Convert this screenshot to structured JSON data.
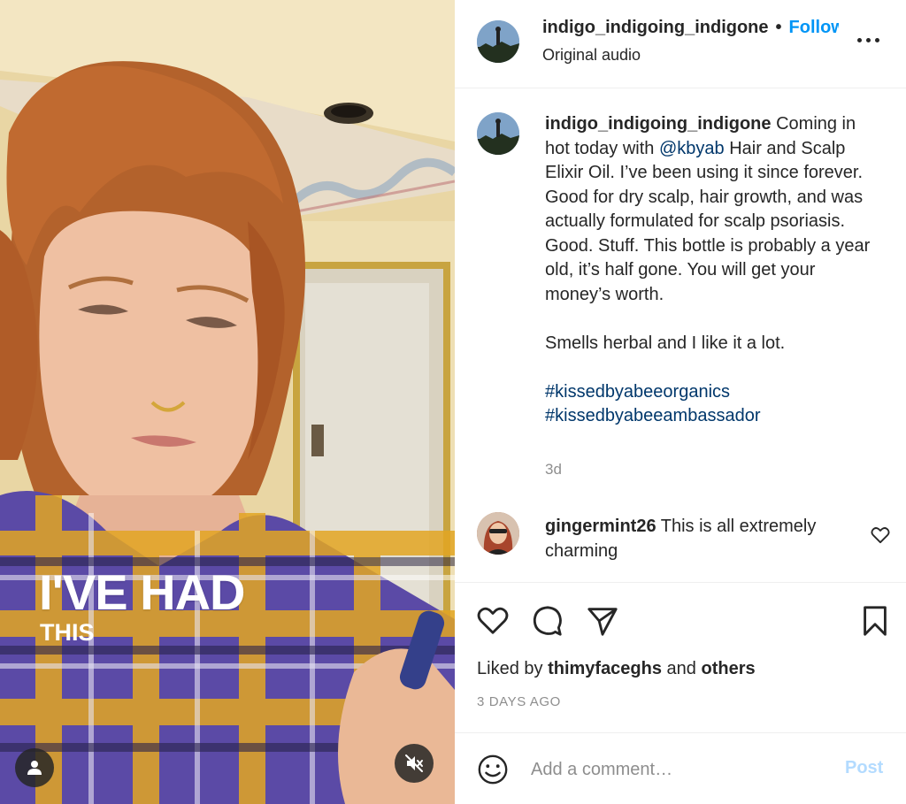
{
  "media": {
    "caption_big": "I'VE HAD",
    "caption_small": "THIS",
    "user_button_icon": "user-icon",
    "mute_button_icon": "speaker-muted-icon"
  },
  "header": {
    "username": "indigo_indigoing_indigone",
    "separator": "•",
    "follow_label": "Follow",
    "audio": "Original audio"
  },
  "caption": {
    "username": "indigo_indigoing_indigone",
    "text_part1": " Coming in hot today with ",
    "mention": "@kbyab",
    "text_part2": " Hair and Scalp Elixir Oil. I’ve been using it since forever. Good for dry scalp, hair growth, and was actually formulated for scalp psoriasis. Good. Stuff. This bottle is probably a year old, it’s half gone. You will get your money’s worth.",
    "text_part3": "Smells herbal and I like it a lot.",
    "hashtag1": "#kissedbyabeeorganics",
    "hashtag2": "#kissedbyabeeambassador",
    "time": "3d"
  },
  "comment": {
    "username": "gingermint26",
    "text": " This is all extremely charming"
  },
  "actions": {
    "liked_by_prefix": "Liked by ",
    "liked_by_user": "thimyfaceghs",
    "liked_by_and": " and ",
    "liked_by_others": "others",
    "date": "3 DAYS AGO"
  },
  "add_comment": {
    "placeholder": "Add a comment…",
    "post_label": "Post"
  },
  "colors": {
    "link_blue": "#0095f6",
    "hashtag_blue": "#00376b",
    "post_disabled": "#b3dbff",
    "muted_text": "#8e8e8e"
  }
}
